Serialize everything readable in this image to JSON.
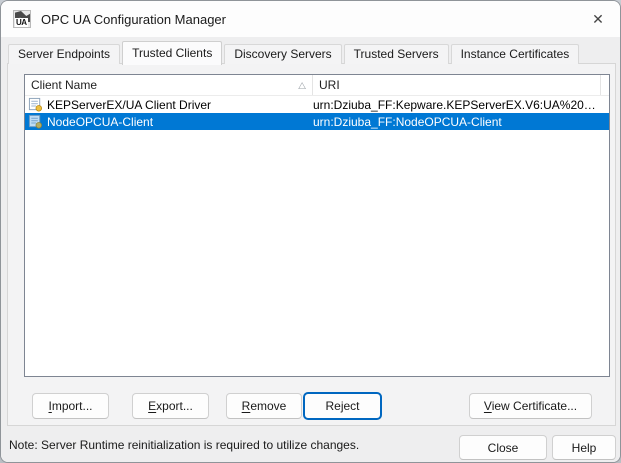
{
  "window": {
    "title": "OPC UA Configuration Manager",
    "icon_text": "UA"
  },
  "icons": {
    "close": "✕",
    "sort_ascending": "△"
  },
  "tabs": [
    {
      "label": "Server Endpoints",
      "active": false
    },
    {
      "label": "Trusted Clients",
      "active": true
    },
    {
      "label": "Discovery Servers",
      "active": false
    },
    {
      "label": "Trusted Servers",
      "active": false
    },
    {
      "label": "Instance Certificates",
      "active": false
    }
  ],
  "list": {
    "columns": [
      {
        "label": "Client Name",
        "sort": "ascending"
      },
      {
        "label": "URI",
        "sort": null
      }
    ],
    "rows": [
      {
        "client_name": "KEPServerEX/UA Client Driver",
        "uri": "urn:Dziuba_FF:Kepware.KEPServerEX.V6:UA%20Clien...",
        "selected": false
      },
      {
        "client_name": "NodeOPCUA-Client",
        "uri": "urn:Dziuba_FF:NodeOPCUA-Client",
        "selected": true
      }
    ]
  },
  "action_buttons": {
    "import": {
      "pre": "",
      "key": "I",
      "post": "mport..."
    },
    "export": {
      "pre": "",
      "key": "E",
      "post": "xport..."
    },
    "remove": {
      "pre": "",
      "key": "R",
      "post": "emove"
    },
    "reject": {
      "label": "Reject",
      "focused": true
    },
    "view_certificate": {
      "pre": "",
      "key": "V",
      "post": "iew Certificate..."
    }
  },
  "footer": {
    "note": "Note: Server Runtime reinitialization is required to utilize changes.",
    "close": "Close",
    "help": "Help"
  },
  "colors": {
    "selection": "#0078d4",
    "focus_border": "#0067c0",
    "titlebar": "#fdfdfd",
    "dialog": "#eeeeef"
  }
}
